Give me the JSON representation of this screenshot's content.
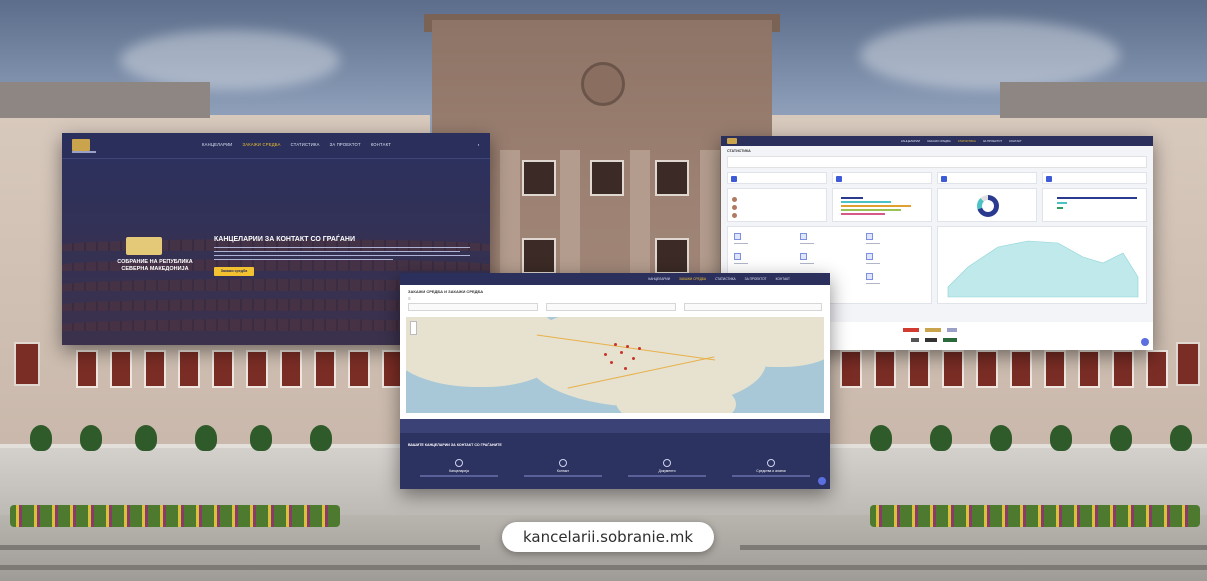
{
  "home_screen": {
    "menu": [
      "КАНЦЕЛАРИИ",
      "ЗАКАЖИ СРЕДБА",
      "СТАТИСТИКА",
      "ЗА ПРОЕКТОТ",
      "КОНТАКТ"
    ],
    "parliament_name": "СОБРАНИЕ НА РЕПУБЛИКА СЕВЕРНА МАКЕДОНИЈА",
    "hero_title": "КАНЦЕЛАРИИ ЗА КОНТАКТ СО ГРАЃАНИ",
    "hero_button": "Закажи средба"
  },
  "map_screen": {
    "page_title": "ЗАКАЖИ СРЕДБА И ЗАКАЖИ СРЕДБА",
    "section_title": "ВАШИТЕ КАНЦЕЛАРИИ ЗА КОНТАКТ СО ГРАЃАНИТЕ",
    "features": [
      "Канцеларија",
      "Контакт",
      "Документи",
      "Средства и алатки"
    ]
  },
  "stats_screen": {
    "page_title": "СТАТИСТИКА"
  },
  "site_url": "kancelarii.sobranie.mk",
  "colors": {
    "navy": "#2d3361",
    "accent_yellow": "#f2c230",
    "stats_blue": "#3d5bd6",
    "area_teal": "#bfe9ea"
  }
}
